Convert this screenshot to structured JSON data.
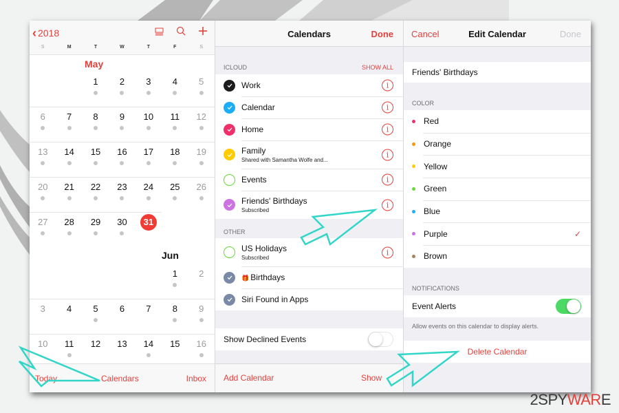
{
  "month_view": {
    "back_label": "2018",
    "weekday_headers": [
      "S",
      "M",
      "T",
      "W",
      "T",
      "F",
      "S"
    ],
    "months": [
      {
        "name": "May",
        "weeks": [
          [
            null,
            null,
            {
              "d": "1",
              "dot": true
            },
            {
              "d": "2",
              "dot": true
            },
            {
              "d": "3",
              "dot": true
            },
            {
              "d": "4",
              "dot": true
            },
            {
              "d": "5",
              "dot": true,
              "dim": true
            }
          ],
          [
            {
              "d": "6",
              "dot": true,
              "dim": true
            },
            {
              "d": "7",
              "dot": true
            },
            {
              "d": "8",
              "dot": true
            },
            {
              "d": "9",
              "dot": true
            },
            {
              "d": "10",
              "dot": true
            },
            {
              "d": "11",
              "dot": true
            },
            {
              "d": "12",
              "dot": true,
              "dim": true
            }
          ],
          [
            {
              "d": "13",
              "dot": true,
              "dim": true
            },
            {
              "d": "14",
              "dot": true
            },
            {
              "d": "15",
              "dot": true
            },
            {
              "d": "16",
              "dot": true
            },
            {
              "d": "17",
              "dot": true
            },
            {
              "d": "18",
              "dot": true
            },
            {
              "d": "19",
              "dot": true,
              "dim": true
            }
          ],
          [
            {
              "d": "20",
              "dot": true,
              "dim": true
            },
            {
              "d": "21",
              "dot": true
            },
            {
              "d": "22",
              "dot": true
            },
            {
              "d": "23",
              "dot": true
            },
            {
              "d": "24",
              "dot": true
            },
            {
              "d": "25",
              "dot": true
            },
            {
              "d": "26",
              "dot": true,
              "dim": true
            }
          ],
          [
            {
              "d": "27",
              "dot": true,
              "dim": true
            },
            {
              "d": "28",
              "dot": true
            },
            {
              "d": "29",
              "dot": true
            },
            {
              "d": "30",
              "dot": true
            },
            {
              "d": "31",
              "dot": false,
              "today": true
            },
            null,
            null
          ]
        ]
      },
      {
        "name": "Jun",
        "weeks": [
          [
            null,
            null,
            null,
            null,
            null,
            {
              "d": "1",
              "dot": true
            },
            {
              "d": "2",
              "dot": false,
              "dim": true
            }
          ],
          [
            {
              "d": "3",
              "dot": false,
              "dim": true
            },
            {
              "d": "4",
              "dot": false
            },
            {
              "d": "5",
              "dot": true
            },
            {
              "d": "6",
              "dot": false
            },
            {
              "d": "7",
              "dot": false
            },
            {
              "d": "8",
              "dot": true
            },
            {
              "d": "9",
              "dot": true,
              "dim": true
            }
          ],
          [
            {
              "d": "10",
              "dot": false,
              "dim": true
            },
            {
              "d": "11",
              "dot": true
            },
            {
              "d": "12",
              "dot": false
            },
            {
              "d": "13",
              "dot": false
            },
            {
              "d": "14",
              "dot": true
            },
            {
              "d": "15",
              "dot": false
            },
            {
              "d": "16",
              "dot": true,
              "dim": true
            }
          ]
        ]
      }
    ],
    "footer": {
      "today": "Today",
      "calendars": "Calendars",
      "inbox": "Inbox"
    }
  },
  "calendars_panel": {
    "title": "Calendars",
    "done": "Done",
    "icloud_header": "ICLOUD",
    "show_all": "SHOW ALL",
    "icloud_items": [
      {
        "name": "Work",
        "sub": "",
        "color": "#1c1c1e",
        "checked": true,
        "info": true
      },
      {
        "name": "Calendar",
        "sub": "",
        "color": "#1badf8",
        "checked": true,
        "info": true
      },
      {
        "name": "Home",
        "sub": "",
        "color": "#f0306b",
        "checked": true,
        "info": true
      },
      {
        "name": "Family",
        "sub": "Shared with Samantha Wolfe and...",
        "color": "#ffcc00",
        "checked": true,
        "info": true
      },
      {
        "name": "Events",
        "sub": "",
        "color": "#63da38",
        "checked": false,
        "info": true
      },
      {
        "name": "Friends' Birthdays",
        "sub": "Subscribed",
        "color": "#cc73e1",
        "checked": true,
        "info": true
      }
    ],
    "other_header": "OTHER",
    "other_items": [
      {
        "name": "US Holidays",
        "sub": "Subscribed",
        "color": "#63da38",
        "checked": false,
        "info": true,
        "gift": false
      },
      {
        "name": "Birthdays",
        "sub": "",
        "color": "#7a8aa6",
        "checked": true,
        "info": false,
        "gift": true
      },
      {
        "name": "Siri Found in Apps",
        "sub": "",
        "color": "#7a8aa6",
        "checked": true,
        "info": false,
        "gift": false
      }
    ],
    "show_declined_label": "Show Declined Events",
    "show_declined_on": false,
    "footer": {
      "add": "Add Calendar",
      "show": "Show"
    }
  },
  "edit_panel": {
    "cancel": "Cancel",
    "title": "Edit Calendar",
    "done": "Done",
    "calendar_name": "Friends' Birthdays",
    "color_header": "COLOR",
    "colors": [
      {
        "name": "Red",
        "hex": "#f0306b",
        "selected": false
      },
      {
        "name": "Orange",
        "hex": "#ff9500",
        "selected": false
      },
      {
        "name": "Yellow",
        "hex": "#ffcc00",
        "selected": false
      },
      {
        "name": "Green",
        "hex": "#63da38",
        "selected": false
      },
      {
        "name": "Blue",
        "hex": "#1badf8",
        "selected": false
      },
      {
        "name": "Purple",
        "hex": "#cc73e1",
        "selected": true
      },
      {
        "name": "Brown",
        "hex": "#a2845e",
        "selected": false
      }
    ],
    "notifications_header": "NOTIFICATIONS",
    "event_alerts_label": "Event Alerts",
    "event_alerts_on": true,
    "alerts_note": "Allow events on this calendar to display alerts.",
    "delete_label": "Delete Calendar"
  },
  "watermark": {
    "part1": "2SPY",
    "part2": "WAR",
    "part3": "E"
  },
  "colors": {
    "accent": "#e0413c",
    "today": "#f03c35",
    "toggle_on": "#4cd964"
  }
}
